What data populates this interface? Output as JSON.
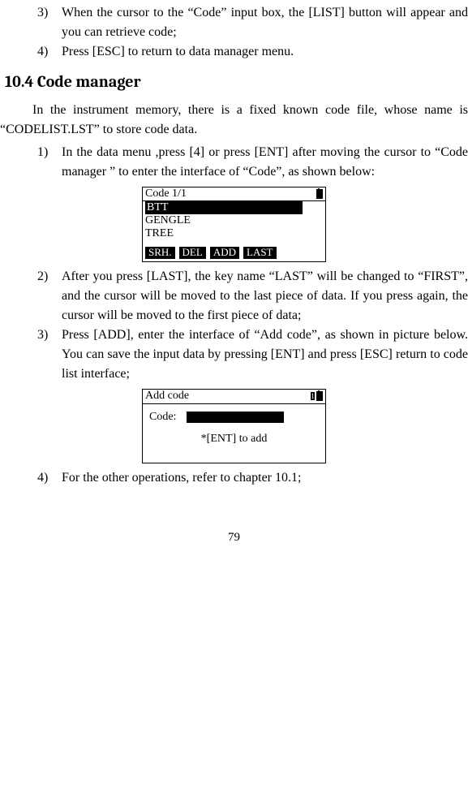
{
  "pageNumber": "79",
  "top_items": {
    "i3": {
      "num": "3)",
      "text": "When the cursor to the “Code” input box, the [LIST] button will appear and you can retrieve code;"
    },
    "i4": {
      "num": "4)",
      "text": "Press [ESC] to return to data manager menu."
    }
  },
  "section_title": "10.4 Code manager",
  "intro1": "In the instrument memory, there is a fixed known code file, whose name is “CODELIST.LST” to store code data.",
  "list": {
    "i1": {
      "num": "1)",
      "text": "In the data menu ,press [4] or press [ENT] after moving the cursor to “Code manager ” to enter the interface of “Code”, as shown below:"
    },
    "i2": {
      "num": "2)",
      "text": "After you press [LAST], the key name “LAST” will be changed to “FIRST”, and the cursor will be moved to the last piece of data. If you press again, the cursor will be moved to the first piece of data;"
    },
    "i3": {
      "num": "3)",
      "text": "Press [ADD], enter the interface of “Add code”, as shown in picture below. You can save the input data by pressing [ENT] and press [ESC] return to code list interface;"
    },
    "i4": {
      "num": "4)",
      "text": "For the other operations, refer to chapter 10.1;"
    }
  },
  "screen1": {
    "title": "Code  1/1",
    "rows": {
      "r1": "BTT",
      "r2": "GENGLE",
      "r3": "TREE"
    },
    "keys": {
      "k1": "SRH.",
      "k2": "DEL",
      "k3": "ADD",
      "k4": "LAST"
    }
  },
  "screen2": {
    "title": "Add code",
    "label": "Code:",
    "hint": "*[ENT] to add"
  }
}
